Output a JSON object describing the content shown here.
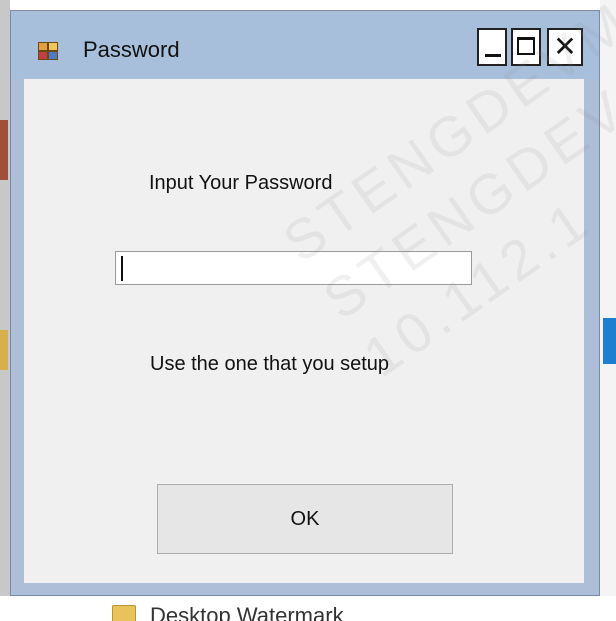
{
  "window": {
    "title": "Password",
    "icon": "app-window-icon",
    "controls": {
      "minimize_icon": "minimize-icon",
      "maximize_icon": "maximize-icon",
      "close_icon": "close-icon",
      "close_glyph": "✕"
    }
  },
  "form": {
    "prompt_label": "Input Your Password",
    "password_value": "",
    "hint_label": "Use the one that you setup",
    "ok_label": "OK"
  },
  "background": {
    "bottom_item_label": "Desktop Watermark",
    "bottom_item_icon": "folder-icon"
  },
  "watermark": {
    "line1": "STENGDEVM",
    "line2": "STENGDEV",
    "line3": "10.112.1"
  },
  "colors": {
    "titlebar": "#a8bfdc",
    "client": "#f0f0f0",
    "button_face": "#e6e6e6",
    "accent_blue": "#1e7fd0"
  }
}
